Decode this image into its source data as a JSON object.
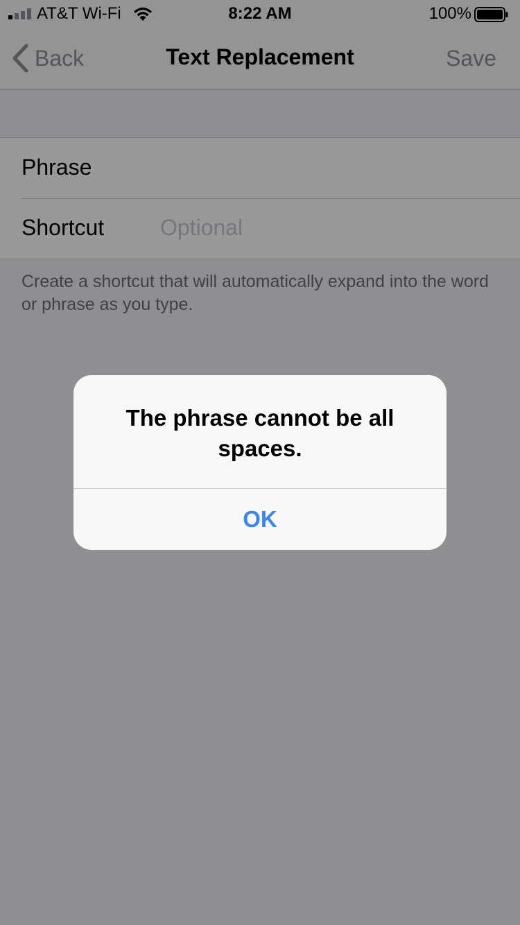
{
  "status_bar": {
    "carrier": "AT&T Wi-Fi",
    "time": "8:22 AM",
    "battery_percent": "100%",
    "battery_level": 1.0
  },
  "nav": {
    "back_label": "Back",
    "title": "Text Replacement",
    "save_label": "Save"
  },
  "form": {
    "phrase_label": "Phrase",
    "phrase_value": "",
    "shortcut_label": "Shortcut",
    "shortcut_placeholder": "Optional",
    "footnote": "Create a shortcut that will automatically expand into the word or phrase as you type."
  },
  "alert": {
    "message": "The phrase cannot be all spaces.",
    "ok_label": "OK"
  },
  "colors": {
    "accent": "#3d85f0",
    "disabled_text": "#8e8e93"
  }
}
